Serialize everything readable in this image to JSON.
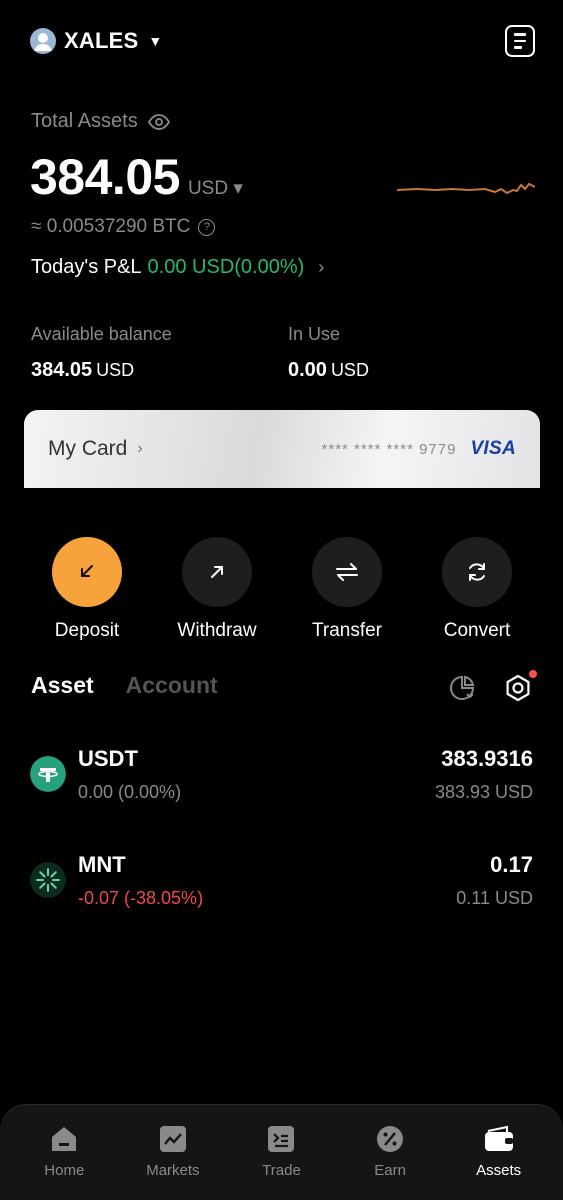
{
  "header": {
    "account_name": "XALES",
    "icons": {
      "avatar": "user-avatar",
      "dropdown": "caret-down-icon",
      "statement": "document-icon"
    }
  },
  "summary": {
    "total_label": "Total Assets",
    "total_value": "384.05",
    "currency": "USD",
    "btc_equiv": "≈ 0.00537290 BTC",
    "pnl_label": "Today's P&L",
    "pnl_value": "0.00 USD(0.00%)"
  },
  "balances": {
    "available_label": "Available balance",
    "available_value": "384.05",
    "available_unit": "USD",
    "inuse_label": "In Use",
    "inuse_value": "0.00",
    "inuse_unit": "USD"
  },
  "card": {
    "title": "My Card",
    "masked_number": "**** **** **** 9779",
    "brand": "VISA"
  },
  "actions": [
    {
      "label": "Deposit",
      "icon": "arrow-down-left-icon"
    },
    {
      "label": "Withdraw",
      "icon": "arrow-up-right-icon"
    },
    {
      "label": "Transfer",
      "icon": "swap-icon"
    },
    {
      "label": "Convert",
      "icon": "refresh-icon"
    }
  ],
  "tabs": {
    "asset": "Asset",
    "account": "Account",
    "active": "Asset"
  },
  "assets": [
    {
      "symbol": "USDT",
      "pnl": "0.00 (0.00%)",
      "amount": "383.9316",
      "usd_value": "383.93 USD",
      "pnl_color": "#8a8a8a"
    },
    {
      "symbol": "MNT",
      "pnl": "-0.07 (-38.05%)",
      "amount": "0.17",
      "usd_value": "0.11 USD",
      "pnl_color": "#f0484f"
    }
  ],
  "nav": [
    {
      "label": "Home",
      "icon": "home-icon"
    },
    {
      "label": "Markets",
      "icon": "chart-icon"
    },
    {
      "label": "Trade",
      "icon": "trade-icon"
    },
    {
      "label": "Earn",
      "icon": "percent-icon"
    },
    {
      "label": "Assets",
      "icon": "wallet-icon",
      "active": true
    }
  ],
  "colors": {
    "accent": "#f7a33c",
    "positive": "#27b96a",
    "negative": "#f0484f",
    "muted": "#8a8a8a"
  }
}
